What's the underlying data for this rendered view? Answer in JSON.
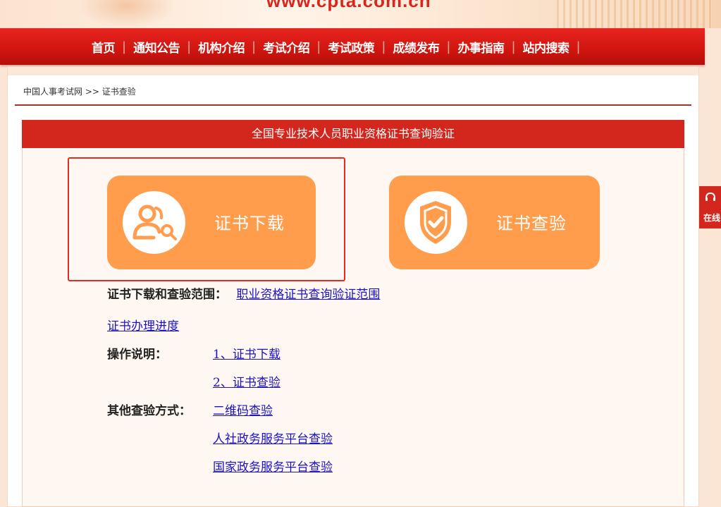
{
  "banner": {
    "url_text": "www.cpta.com.cn"
  },
  "nav": {
    "items": [
      "首页",
      "通知公告",
      "机构介绍",
      "考试介绍",
      "考试政策",
      "成绩发布",
      "办事指南",
      "站内搜索"
    ]
  },
  "breadcrumb": {
    "home": "中国人事考试网",
    "sep": ">>",
    "current": "证书查验"
  },
  "box": {
    "title": "全国专业技术人员职业资格证书查询验证"
  },
  "cards": {
    "download": {
      "label": "证书下载",
      "icon": "user-search-icon"
    },
    "verify": {
      "label": "证书查验",
      "icon": "shield-check-icon"
    }
  },
  "info": {
    "scope_label": "证书下载和查验范围：",
    "scope_link": "职业资格证书查询验证范围",
    "progress_link": "证书办理进度",
    "ops_label": "操作说明：",
    "ops_link1": "1、证书下载",
    "ops_link2": "2、证书查验",
    "other_label": "其他查验方式：",
    "other_link1": "二维码查验",
    "other_link2": "人社政务服务平台查验",
    "other_link3": "国家政务服务平台查验"
  },
  "side_tab": {
    "label": "在线",
    "icon": "headset-icon"
  },
  "colors": {
    "primary_red": "#d3271d",
    "card_orange": "#ff9d4d",
    "link_blue": "#1a12c8"
  }
}
